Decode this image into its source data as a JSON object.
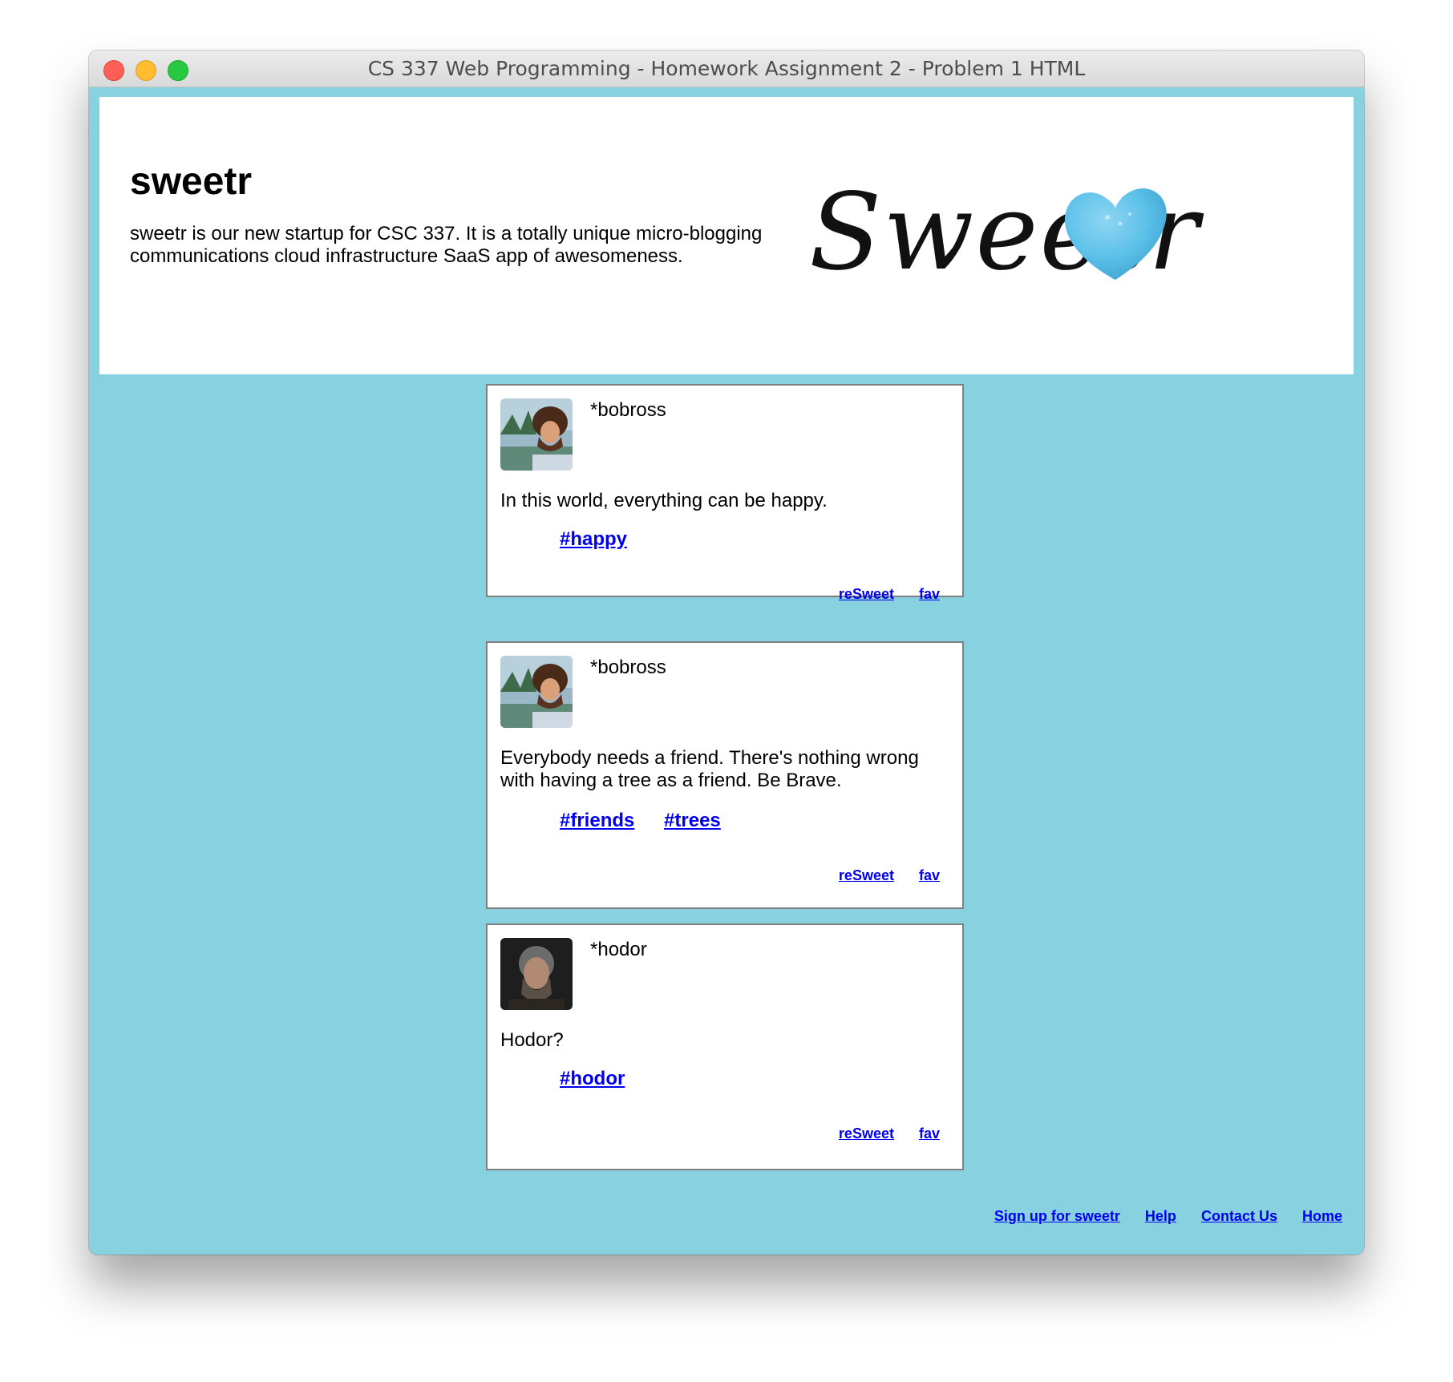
{
  "window": {
    "title": "CS 337 Web Programming - Homework Assignment 2 - Problem 1 HTML"
  },
  "colors": {
    "page_background": "#87d1e1",
    "link": "#0000ee",
    "heart": "#5bc0e8"
  },
  "header": {
    "title": "sweetr",
    "description": "sweetr is our new startup for CSC 337. It is a totally unique micro-blogging communications cloud infrastructure SaaS app of awesomeness.",
    "logo_text": "Sweetr"
  },
  "sweets": [
    {
      "username": "*bobross",
      "avatar": "bobross-avatar",
      "text": "In this world, everything can be happy.",
      "tags": [
        "#happy"
      ],
      "actions": [
        "reSweet",
        "fav"
      ]
    },
    {
      "username": "*bobross",
      "avatar": "bobross-avatar",
      "text": "Everybody needs a friend. There's nothing wrong with having a tree as a friend. Be Brave.",
      "tags": [
        "#friends",
        "#trees"
      ],
      "actions": [
        "reSweet",
        "fav"
      ]
    },
    {
      "username": "*hodor",
      "avatar": "hodor-avatar",
      "text": "Hodor?",
      "tags": [
        "#hodor"
      ],
      "actions": [
        "reSweet",
        "fav"
      ]
    }
  ],
  "footer": {
    "links": [
      "Sign up for sweetr",
      "Help",
      "Contact Us",
      "Home"
    ]
  }
}
